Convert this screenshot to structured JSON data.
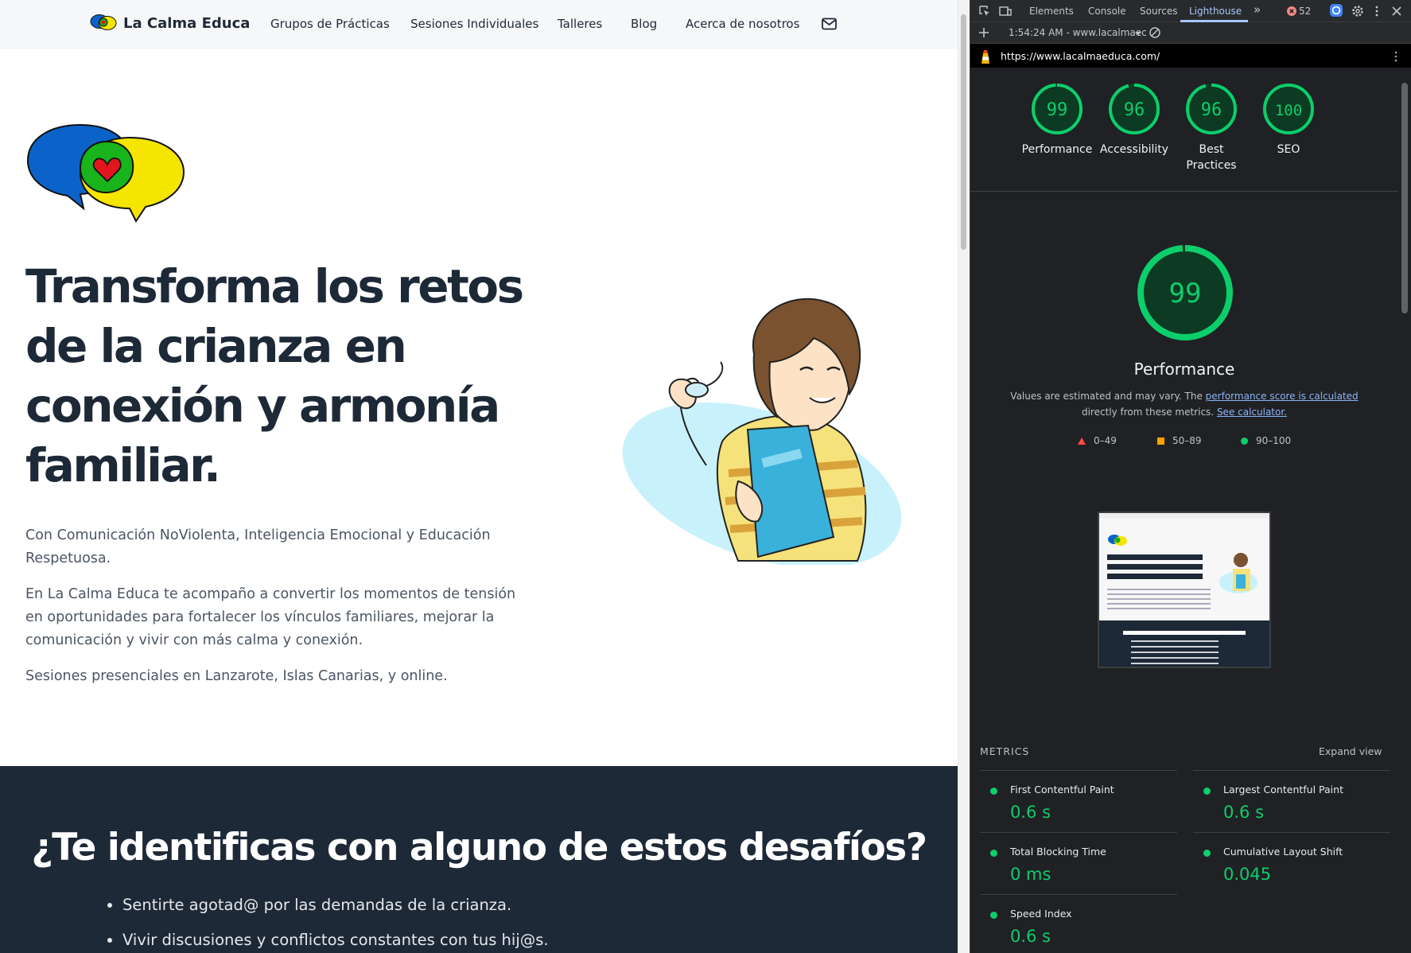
{
  "site": {
    "brand_name": "La Calma Educa",
    "nav": [
      "Grupos de Prácticas",
      "Sesiones Individuales",
      "Talleres",
      "Blog",
      "Acerca de nosotros"
    ],
    "mail_icon": "mail-icon",
    "hero": {
      "title": "Transforma los retos de la crianza en conexión y armonía familiar.",
      "paragraphs": [
        "Con Comunicación NoViolenta, Inteligencia Emocional y Educación Respetuosa.",
        "En La Calma Educa te acompaño a convertir los momentos de tensión en oportunidades para fortalecer los vínculos familiares, mejorar la comunicación y vivir con más calma y conexión.",
        "Sesiones presenciales en Lanzarote, Islas Canarias, y online."
      ]
    },
    "challenges": {
      "title": "¿Te identificas con alguno de estos desafíos?",
      "items": [
        "Sentirte agotad@ por las demandas de la crianza.",
        "Vivir discusiones y conflictos constantes con tus hij@s."
      ]
    }
  },
  "devtools": {
    "tabs": [
      "Elements",
      "Console",
      "Sources",
      "Lighthouse"
    ],
    "active_tab": "Lighthouse",
    "more_tabs": "»",
    "error_count": "52",
    "report_time": "1:54:24 AM - www.lacalmaec",
    "url": "https://www.lacalmaeduca.com/",
    "scores": [
      {
        "label": "Performance",
        "value": 99
      },
      {
        "label": "Accessibility",
        "value": 96
      },
      {
        "label": "Best Practices",
        "value": 96
      },
      {
        "label": "SEO",
        "value": 100
      }
    ],
    "performance": {
      "title": "Performance",
      "score": 99,
      "note_prefix": "Values are estimated and may vary. The ",
      "note_link1": "performance score is calculated",
      "note_middle": " directly from these metrics. ",
      "note_link2": "See calculator."
    },
    "legend": [
      "0–49",
      "50–89",
      "90–100"
    ],
    "metrics_heading": "METRICS",
    "expand_view": "Expand view",
    "metrics": [
      {
        "name": "First Contentful Paint",
        "value": "0.6 s"
      },
      {
        "name": "Largest Contentful Paint",
        "value": "0.6 s"
      },
      {
        "name": "Total Blocking Time",
        "value": "0 ms"
      },
      {
        "name": "Cumulative Layout Shift",
        "value": "0.045"
      },
      {
        "name": "Speed Index",
        "value": "0.6 s"
      }
    ],
    "colors": {
      "good": "#0cce6b",
      "average": "#ffa400",
      "fail": "#ff4e42",
      "accent": "#a8c7fa"
    }
  }
}
